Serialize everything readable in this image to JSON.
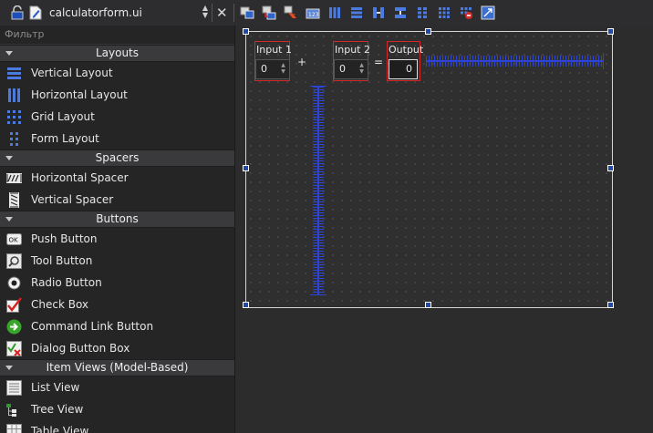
{
  "toolbar": {
    "file_name": "calculatorform.ui",
    "icons": [
      "lock-icon",
      "edit-file-icon",
      "updown-icon",
      "close-icon",
      "edit-widgets-icon",
      "edit-signals-slots-icon",
      "edit-buddies-icon",
      "edit-tab-order-icon",
      "layout-horizontal-icon",
      "layout-vertical-icon",
      "layout-horizontal-splitter-icon",
      "layout-vertical-splitter-icon",
      "layout-form-icon",
      "layout-grid-icon",
      "break-layout-icon",
      "adjust-size-icon"
    ]
  },
  "widget_box": {
    "filter_placeholder": "Фильтр",
    "categories": [
      {
        "title": "Layouts",
        "items": [
          {
            "label": "Vertical Layout",
            "icon": "vertical-layout-icon"
          },
          {
            "label": "Horizontal Layout",
            "icon": "horizontal-layout-icon"
          },
          {
            "label": "Grid Layout",
            "icon": "grid-layout-icon"
          },
          {
            "label": "Form Layout",
            "icon": "form-layout-icon"
          }
        ]
      },
      {
        "title": "Spacers",
        "items": [
          {
            "label": "Horizontal Spacer",
            "icon": "horizontal-spacer-icon"
          },
          {
            "label": "Vertical Spacer",
            "icon": "vertical-spacer-icon"
          }
        ]
      },
      {
        "title": "Buttons",
        "items": [
          {
            "label": "Push Button",
            "icon": "push-button-icon"
          },
          {
            "label": "Tool Button",
            "icon": "tool-button-icon"
          },
          {
            "label": "Radio Button",
            "icon": "radio-button-icon"
          },
          {
            "label": "Check Box",
            "icon": "check-box-icon"
          },
          {
            "label": "Command Link Button",
            "icon": "command-link-icon"
          },
          {
            "label": "Dialog Button Box",
            "icon": "dialog-button-box-icon"
          }
        ]
      },
      {
        "title": "Item Views (Model-Based)",
        "items": [
          {
            "label": "List View",
            "icon": "list-view-icon"
          },
          {
            "label": "Tree View",
            "icon": "tree-view-icon"
          },
          {
            "label": "Table View",
            "icon": "table-view-icon"
          }
        ]
      }
    ]
  },
  "form": {
    "input1_label": "Input 1",
    "input1_value": "0",
    "plus": "+",
    "input2_label": "Input 2",
    "input2_value": "0",
    "equals": "=",
    "output_label": "Output",
    "output_value": "0"
  },
  "colors": {
    "selection_border": "#d02828",
    "spacer": "#2d42d6",
    "handle": "#1f4aa8"
  }
}
